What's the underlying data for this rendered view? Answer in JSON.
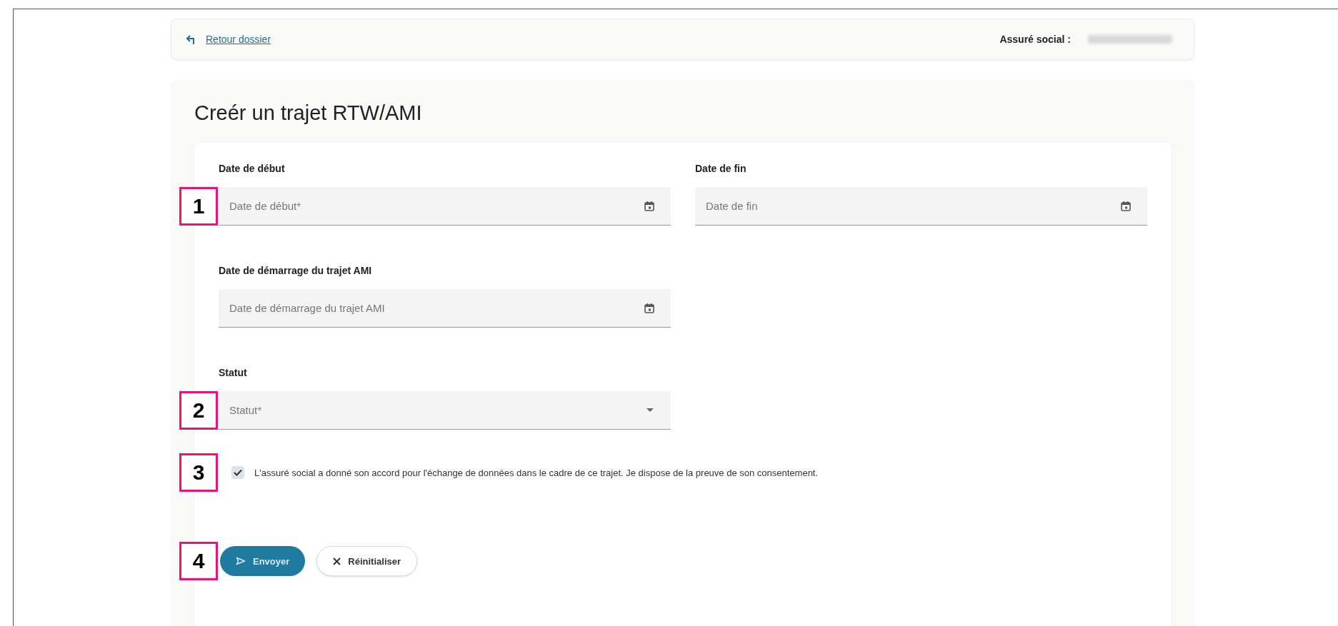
{
  "top_bar": {
    "back_link": "Retour dossier",
    "insured_label": "Assuré social :"
  },
  "form": {
    "title": "Creér un trajet RTW/AMI",
    "rows": [
      [
        {
          "kind": "date",
          "label": "Date de début",
          "placeholder": "Date de début*",
          "callout": "1"
        },
        {
          "kind": "date",
          "label": "Date de fin",
          "placeholder": "Date de fin"
        }
      ],
      [
        {
          "kind": "date",
          "label": "Date de démarrage du trajet AMI",
          "placeholder": "Date de démarrage du trajet AMI"
        }
      ],
      [
        {
          "kind": "select",
          "label": "Statut",
          "placeholder": "Statut*",
          "callout": "2"
        }
      ]
    ],
    "consent": {
      "checked": true,
      "text": "L'assuré social a donné son accord pour l'échange de données dans le cadre de ce trajet. Je dispose de la preuve de son consentement.",
      "callout": "3"
    },
    "buttons": [
      {
        "kind": "primary",
        "label": "Envoyer"
      },
      {
        "kind": "secondary",
        "label": "Réinitialiser"
      }
    ],
    "buttons_callout": "4"
  }
}
